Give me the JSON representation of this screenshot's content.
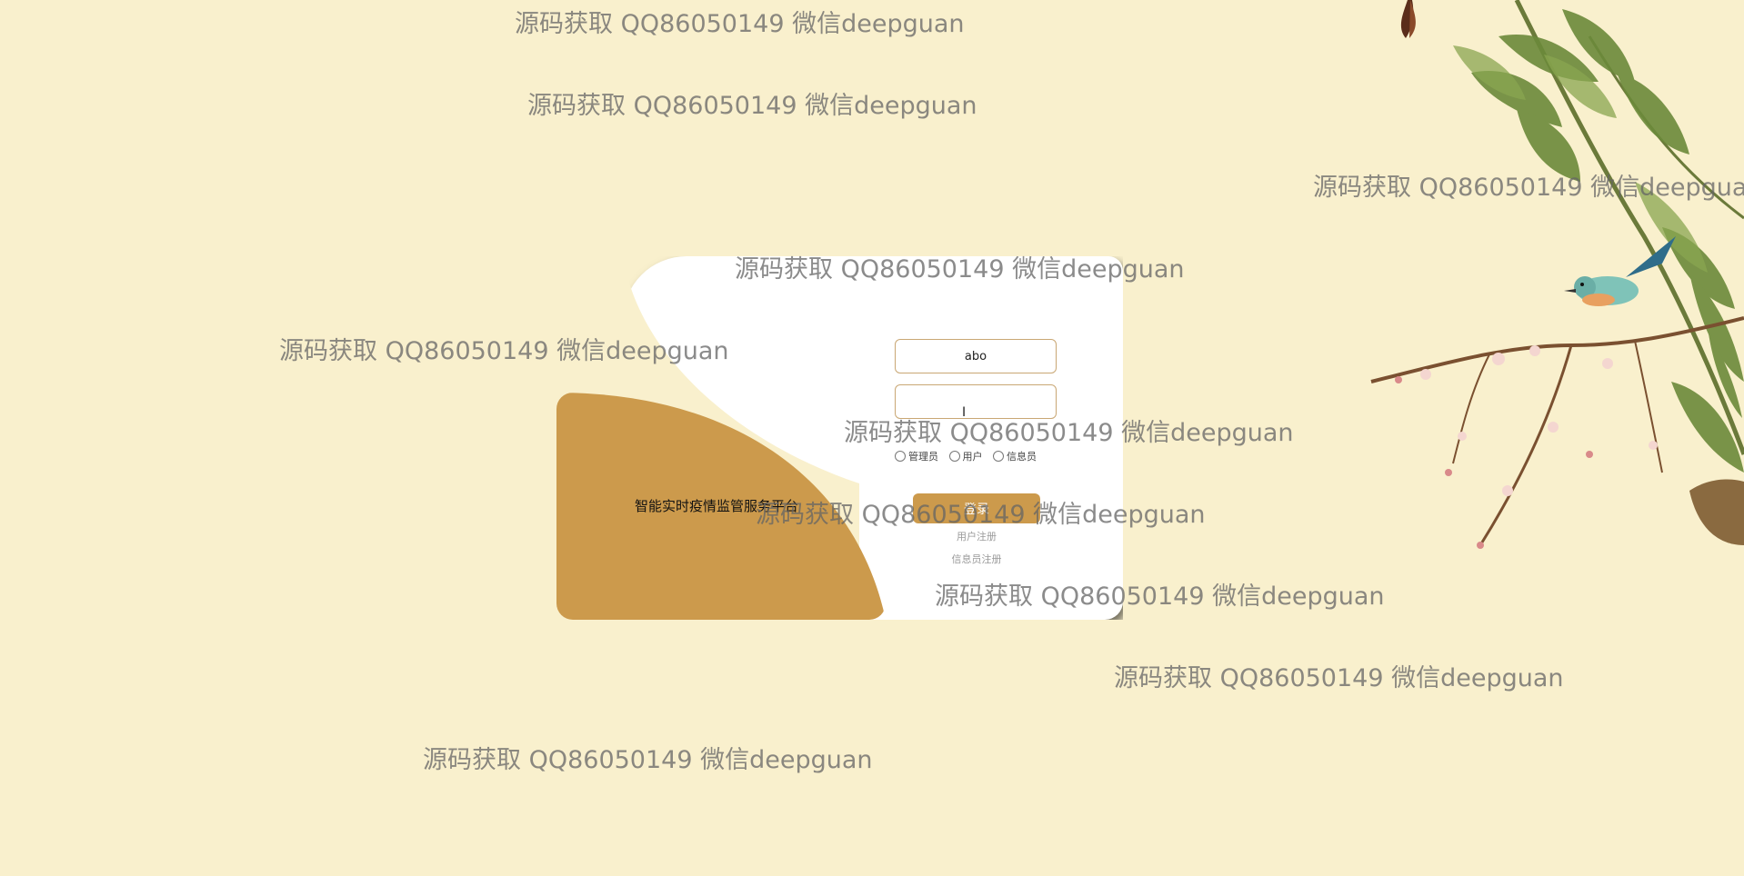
{
  "brand": {
    "title": "智能实时疫情监管服务平台"
  },
  "login": {
    "username_value": "abo",
    "password_value": "",
    "roles": [
      "管理员",
      "用户",
      "信息员"
    ],
    "login_label": "登录",
    "register_user_label": "用户注册",
    "register_info_label": "信息员注册"
  },
  "watermark": {
    "text": "源码获取 QQ86050149 微信deepguan"
  },
  "colors": {
    "background": "#f9f0cd",
    "accent": "#cc9a4c",
    "card": "#ffffff"
  }
}
